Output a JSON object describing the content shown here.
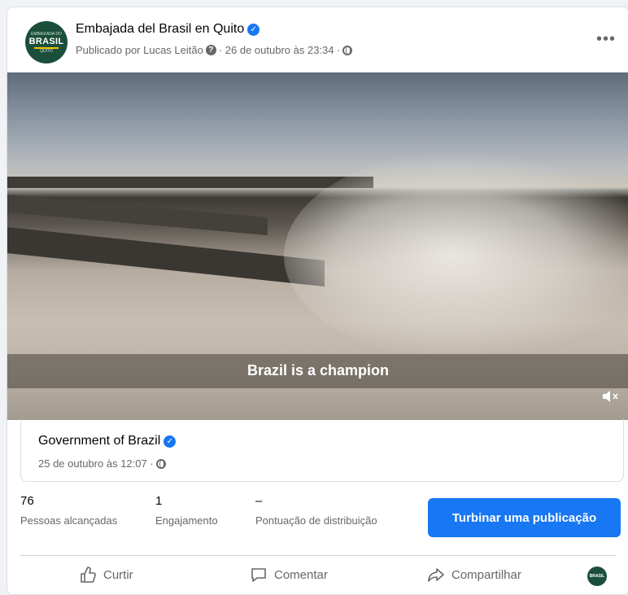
{
  "post": {
    "page_name": "Embajada del Brasil en Quito",
    "published_by": "Publicado por Lucas Leitão",
    "date": "· 26 de outubro às 23:34 ·",
    "avatar_small_text": "EMBAIXADA DO",
    "avatar_big_text": "BRASIL",
    "avatar_bottom_text": "QUITO"
  },
  "video": {
    "caption": "Brazil is a champion"
  },
  "shared": {
    "name": "Government of Brazil",
    "date": "25 de outubro às 12:07 ·"
  },
  "stats": [
    {
      "value": "76",
      "label": "Pessoas alcançadas"
    },
    {
      "value": "1",
      "label": "Engajamento"
    },
    {
      "value": "–",
      "label": "Pontuação de distribuição"
    }
  ],
  "boost_button": "Turbinar uma publicação",
  "actions": {
    "like": "Curtir",
    "comment": "Comentar",
    "share": "Compartilhar",
    "avatar_text": "BRASIL"
  },
  "colors": {
    "accent": "#1877f2",
    "avatar_bg": "#1b4f3c"
  }
}
